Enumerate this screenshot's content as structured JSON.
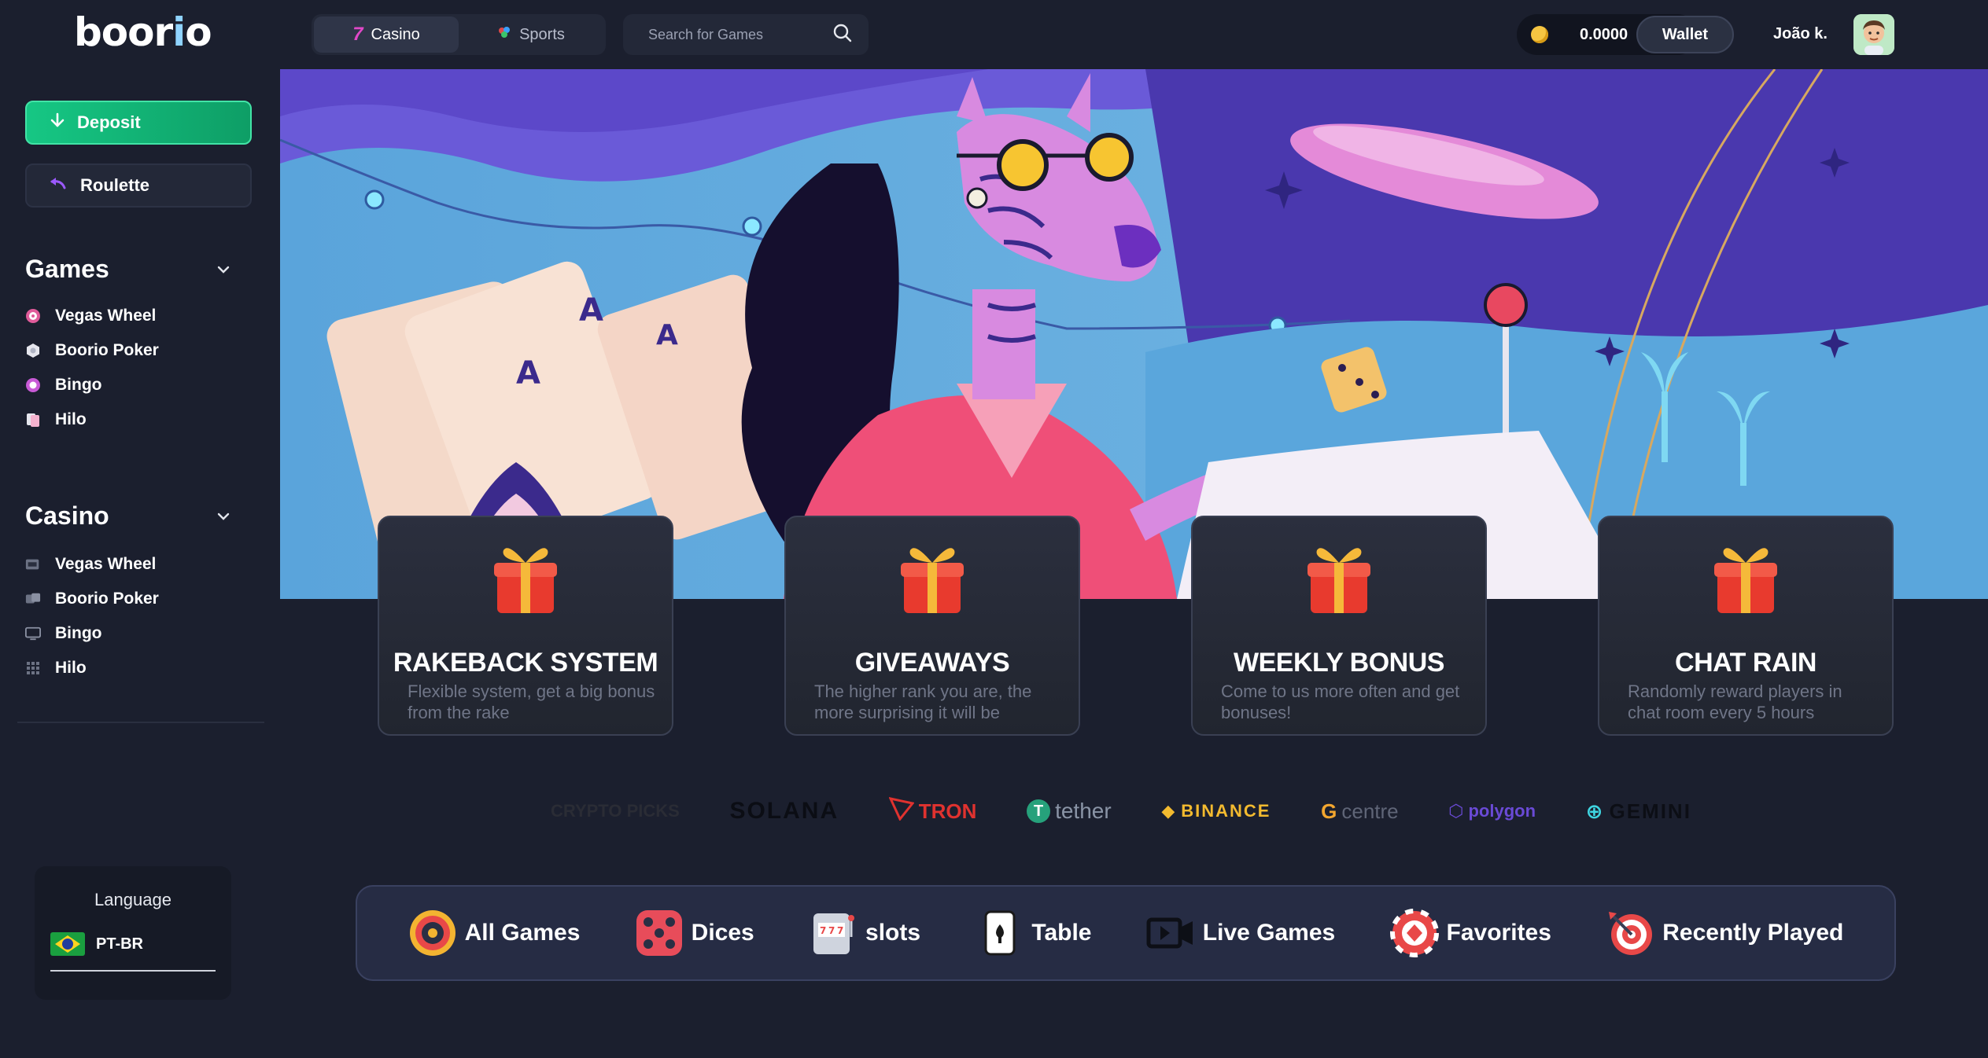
{
  "header": {
    "logo": {
      "main": "boor",
      "accent": "i",
      "end": "o"
    },
    "modes": [
      {
        "label": "Casino",
        "icon": "seven-icon",
        "active": true
      },
      {
        "label": "Sports",
        "icon": "sports-ball-icon",
        "active": false
      }
    ],
    "search": {
      "placeholder": "Search for Games"
    },
    "balance": "0.0000",
    "wallet_label": "Wallet",
    "username": "João k."
  },
  "sidebar": {
    "deposit_label": "Deposit",
    "roulette_label": "Roulette",
    "games": {
      "title": "Games",
      "items": [
        {
          "label": "Vegas Wheel",
          "icon": "wheel-icon"
        },
        {
          "label": "Boorio Poker",
          "icon": "poker-chip-icon"
        },
        {
          "label": "Bingo",
          "icon": "bingo-ball-icon"
        },
        {
          "label": "Hilo",
          "icon": "cards-icon"
        }
      ]
    },
    "casino": {
      "title": "Casino",
      "items": [
        {
          "label": "Vegas Wheel",
          "icon": "slot-machine-icon"
        },
        {
          "label": "Boorio Poker",
          "icon": "dice-icon"
        },
        {
          "label": "Bingo",
          "icon": "monitor-icon"
        },
        {
          "label": "Hilo",
          "icon": "grid-icon"
        }
      ]
    },
    "language": {
      "title": "Language",
      "current": "PT-BR"
    }
  },
  "features": [
    {
      "title": "RAKEBACK SYSTEM",
      "desc": "Flexible system, get a big bonus from the rake"
    },
    {
      "title": "GIVEAWAYS",
      "desc": "The higher rank you are, the more surprising it will be"
    },
    {
      "title": "WEEKLY BONUS",
      "desc": "Come to us more often and get bonuses!"
    },
    {
      "title": "CHAT RAIN",
      "desc": "Randomly reward players in chat room every 5 hours"
    }
  ],
  "partners": [
    "CRYPTO PICKS",
    "SOLANA",
    "TRON",
    "tether",
    "BINANCE",
    "centre",
    "polygon",
    "GEMINI"
  ],
  "categories": [
    {
      "label": "All Games",
      "icon": "roulette-wheel-icon"
    },
    {
      "label": "Dices",
      "icon": "dice-icon"
    },
    {
      "label": "slots",
      "icon": "slot-machine-icon"
    },
    {
      "label": "Table",
      "icon": "playing-card-icon"
    },
    {
      "label": "Live Games",
      "icon": "video-camera-icon"
    },
    {
      "label": "Favorites",
      "icon": "poker-chip-icon"
    },
    {
      "label": "Recently Played",
      "icon": "target-icon"
    }
  ],
  "colors": {
    "background": "#1b1f2e",
    "deposit_green": "#16c784",
    "hero_sky": "#5b9fd8",
    "hero_purple": "#4b3fb0",
    "card_text_muted": "#6f7587"
  }
}
